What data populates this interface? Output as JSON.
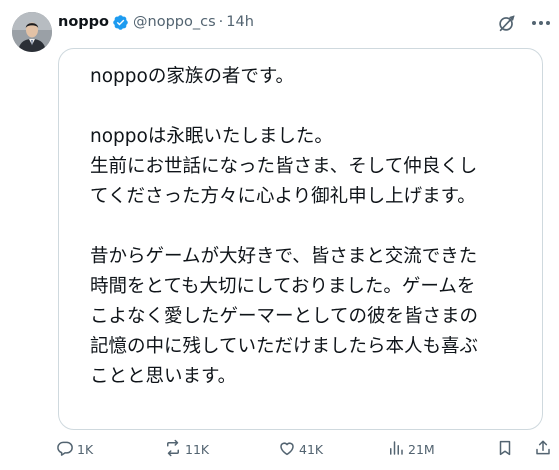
{
  "author": {
    "display_name": "noppo",
    "handle": "@noppo_cs",
    "separator": "·",
    "time": "14h"
  },
  "icons": {
    "verified": "verified-badge-icon",
    "grok": "grok-icon",
    "more": "more-icon",
    "reply": "reply-icon",
    "retweet": "retweet-icon",
    "like": "like-icon",
    "views": "views-icon",
    "bookmark": "bookmark-icon",
    "share": "share-icon"
  },
  "colors": {
    "verified_blue": "#1d9bf0",
    "secondary_text": "#536471",
    "border": "#cfd9de"
  },
  "post": {
    "lines": [
      "noppoの家族の者です。",
      "",
      "noppoは永眠いたしました。",
      "生前にお世話になった皆さま、そして仲良くし",
      "てくださった方々に心より御礼申し上げます。",
      "",
      "昔からゲームが大好きで、皆さまと交流できた",
      "時間をとても大切にしておりました。ゲームを",
      "こよなく愛したゲーマーとしての彼を皆さまの",
      "記憶の中に残していただけましたら本人も喜ぶ",
      "ことと思います。"
    ]
  },
  "actions": {
    "replies": "1K",
    "retweets": "11K",
    "likes": "41K",
    "views": "21M"
  }
}
